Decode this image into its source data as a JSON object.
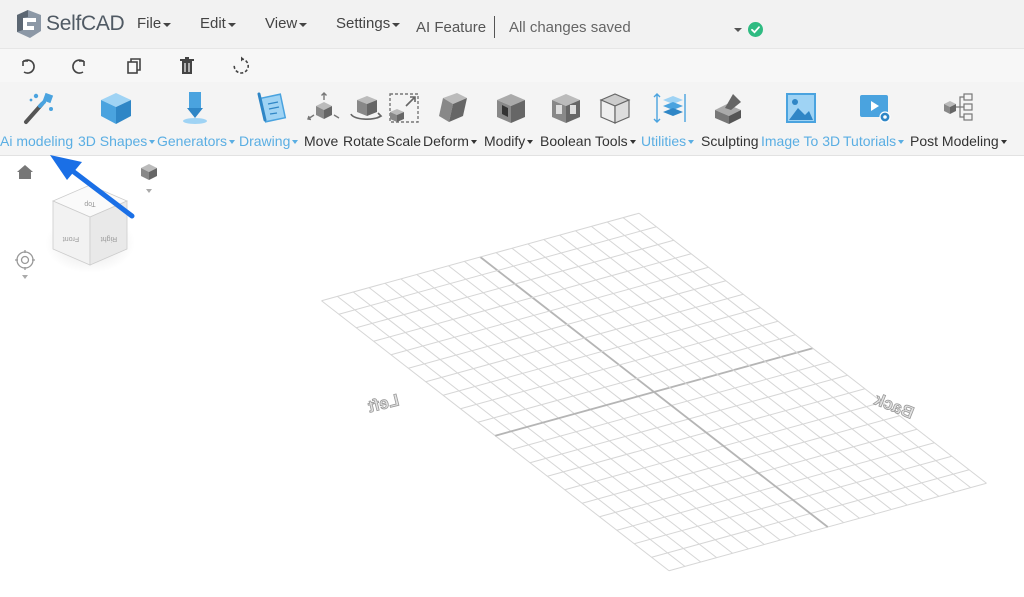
{
  "app": {
    "name": "SelfCAD",
    "status": "All changes saved",
    "ai_feature": "AI Feature",
    "accent": "#5aaee3",
    "ok_color": "#2fbb82"
  },
  "menu": [
    {
      "label": "File"
    },
    {
      "label": "Edit"
    },
    {
      "label": "View"
    },
    {
      "label": "Settings"
    }
  ],
  "actions": [
    {
      "icon": "undo-icon"
    },
    {
      "icon": "redo-icon"
    },
    {
      "icon": "copy-icon"
    },
    {
      "icon": "delete-icon"
    },
    {
      "icon": "reset-icon"
    }
  ],
  "tools": [
    {
      "label": "Ai modeling",
      "icon": "ai-wand-icon"
    },
    {
      "label": "3D Shapes",
      "icon": "cube-icon"
    },
    {
      "label": "Generators",
      "icon": "generator-icon"
    },
    {
      "label": "Drawing",
      "icon": "drawing-icon"
    },
    {
      "label": "Move",
      "icon": "move-icon"
    },
    {
      "label": "Rotate",
      "icon": "rotate-icon"
    },
    {
      "label": "Scale",
      "icon": "scale-icon"
    },
    {
      "label": "Deform",
      "icon": "deform-icon"
    },
    {
      "label": "Modify",
      "icon": "modify-icon"
    },
    {
      "label": "Boolean",
      "icon": "boolean-icon"
    },
    {
      "label": "Tools",
      "icon": "tools-icon"
    },
    {
      "label": "Utilities",
      "icon": "utilities-icon"
    },
    {
      "label": "Sculpting",
      "icon": "sculpting-icon"
    },
    {
      "label": "Image To 3D",
      "icon": "image-to-3d-icon"
    },
    {
      "label": "Tutorials",
      "icon": "tutorials-icon"
    },
    {
      "label": "Post Modeling",
      "icon": "post-modeling-icon"
    }
  ],
  "viewport": {
    "grid_labels": {
      "left": "Left",
      "back": "Back"
    },
    "view_cube": {
      "front": "Front",
      "right": "Right",
      "top": "Top"
    },
    "annotation_color": "#1a6fe6"
  }
}
